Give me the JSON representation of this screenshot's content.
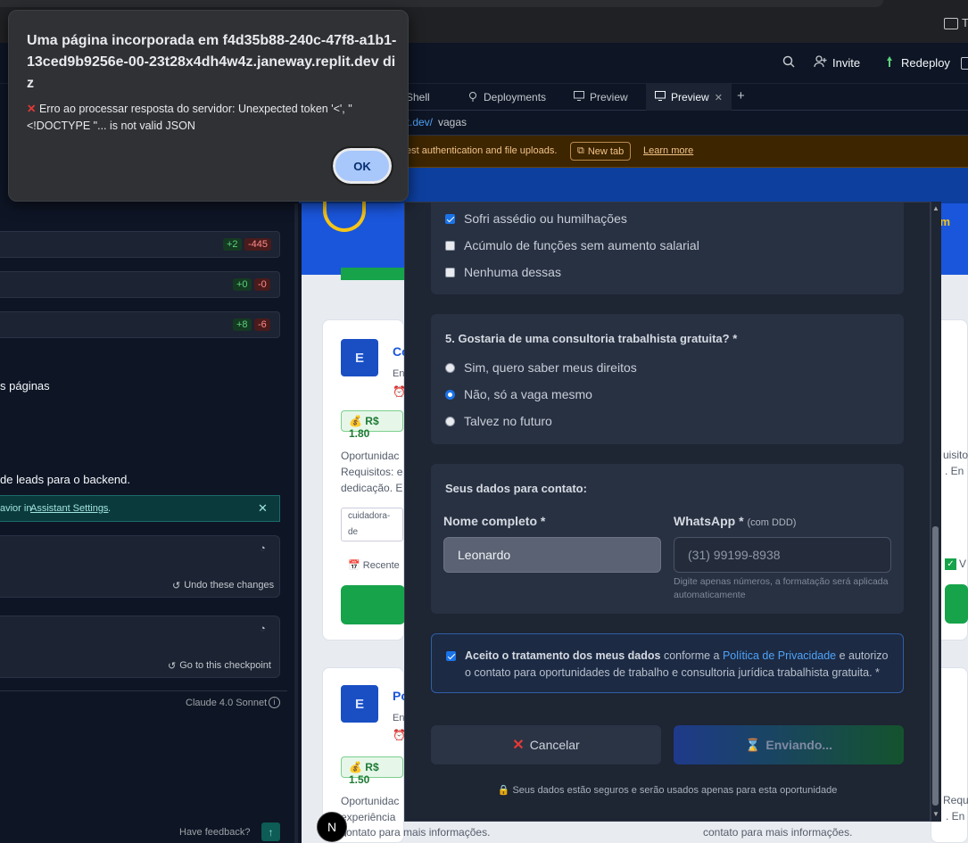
{
  "browser": {
    "bookmark_text": "T"
  },
  "header": {
    "search_icon": "search-icon",
    "invite_label": "Invite",
    "redeploy_label": "Redeploy"
  },
  "tabs": [
    {
      "label": "Shell"
    },
    {
      "label": "Deployments"
    },
    {
      "label": "Preview"
    },
    {
      "label": "Preview"
    }
  ],
  "url": {
    "domain": "it.dev/",
    "path": "vagas"
  },
  "warning": {
    "text": "est authentication and file uploads.",
    "new_tab": "New tab",
    "learn_more": "Learn more"
  },
  "left_panel": {
    "diff_rows": [
      {
        "plus": "+2",
        "minus": "-445"
      },
      {
        "plus": "+0",
        "minus": "-0"
      },
      {
        "plus": "+8",
        "minus": "-6"
      }
    ],
    "text_paginas": "s páginas",
    "text_leads": "de leads para o backend.",
    "info_prefix": "avior in ",
    "info_link": "Assistant Settings",
    "info_suffix": ".",
    "undo_label": "Undo these changes",
    "checkpoint_label": "Go to this checkpoint",
    "model": "Claude 4.0 Sonnet",
    "feedback": "Have feedback?"
  },
  "preview": {
    "hero_right": "a Em",
    "cards": [
      {
        "logo": "E",
        "title": "Co",
        "sub": "En",
        "salary": "R$ 1.80",
        "desc1": "Oportunidac",
        "desc2": "Requisitos: e",
        "desc3": "dedicação. E",
        "tag": "cuidadora-de",
        "recent": "Recente"
      },
      {
        "logo": "E",
        "title": "Po",
        "sub": "En",
        "salary": "R$ 1.50",
        "desc1": "Oportunidac",
        "desc2": "experiência n",
        "desc3": "contato para mais informações."
      }
    ],
    "right_frag": {
      "r1": "uisito",
      "r2": ". En",
      "r3": "Requi",
      "r4": ". En",
      "r5": "contato para mais informações.",
      "v": "V"
    }
  },
  "modal": {
    "q4_options": [
      {
        "label": "Sofri assédio ou humilhações",
        "checked": true
      },
      {
        "label": "Acúmulo de funções sem aumento salarial",
        "checked": false
      },
      {
        "label": "Nenhuma dessas",
        "checked": false
      }
    ],
    "q5_title": "5. Gostaria de uma consultoria trabalhista gratuita? *",
    "q5_options": [
      {
        "label": "Sim, quero saber meus direitos",
        "checked": false
      },
      {
        "label": "Não, só a vaga mesmo",
        "checked": true
      },
      {
        "label": "Talvez no futuro",
        "checked": false
      }
    ],
    "contact_title": "Seus dados para contato:",
    "name_label": "Nome completo *",
    "name_value": "Leonardo",
    "whatsapp_label": "WhatsApp *",
    "whatsapp_hint_label": "(com DDD)",
    "whatsapp_placeholder": "(31) 99199-8938",
    "whatsapp_hint1": "Digite apenas números, a formatação será aplicada",
    "whatsapp_hint2": "automaticamente",
    "consent_bold": "Aceito o tratamento dos meus dados",
    "consent_mid": " conforme a ",
    "consent_link": "Política de Privacidade",
    "consent_rest1": " e autorizo",
    "consent_rest2": "o contato para oportunidades de trabalho e consultoria jurídica trabalhista gratuita. *",
    "cancel_label": "Cancelar",
    "send_label": "Enviando...",
    "secure_note": "Seus dados estão seguros e serão usados apenas para esta oportunidade"
  },
  "dialog": {
    "title": "Uma página incorporada em f4d35b88-240c-47f8-a1b1-13ced9b9256e-00-23t28x4dh4w4z.janeway.replit.dev diz",
    "message": "Erro ao processar resposta do servidor: Unexpected token '<', \"<!DOCTYPE \"... is not valid JSON",
    "ok_label": "OK"
  },
  "nav_letter": "N"
}
